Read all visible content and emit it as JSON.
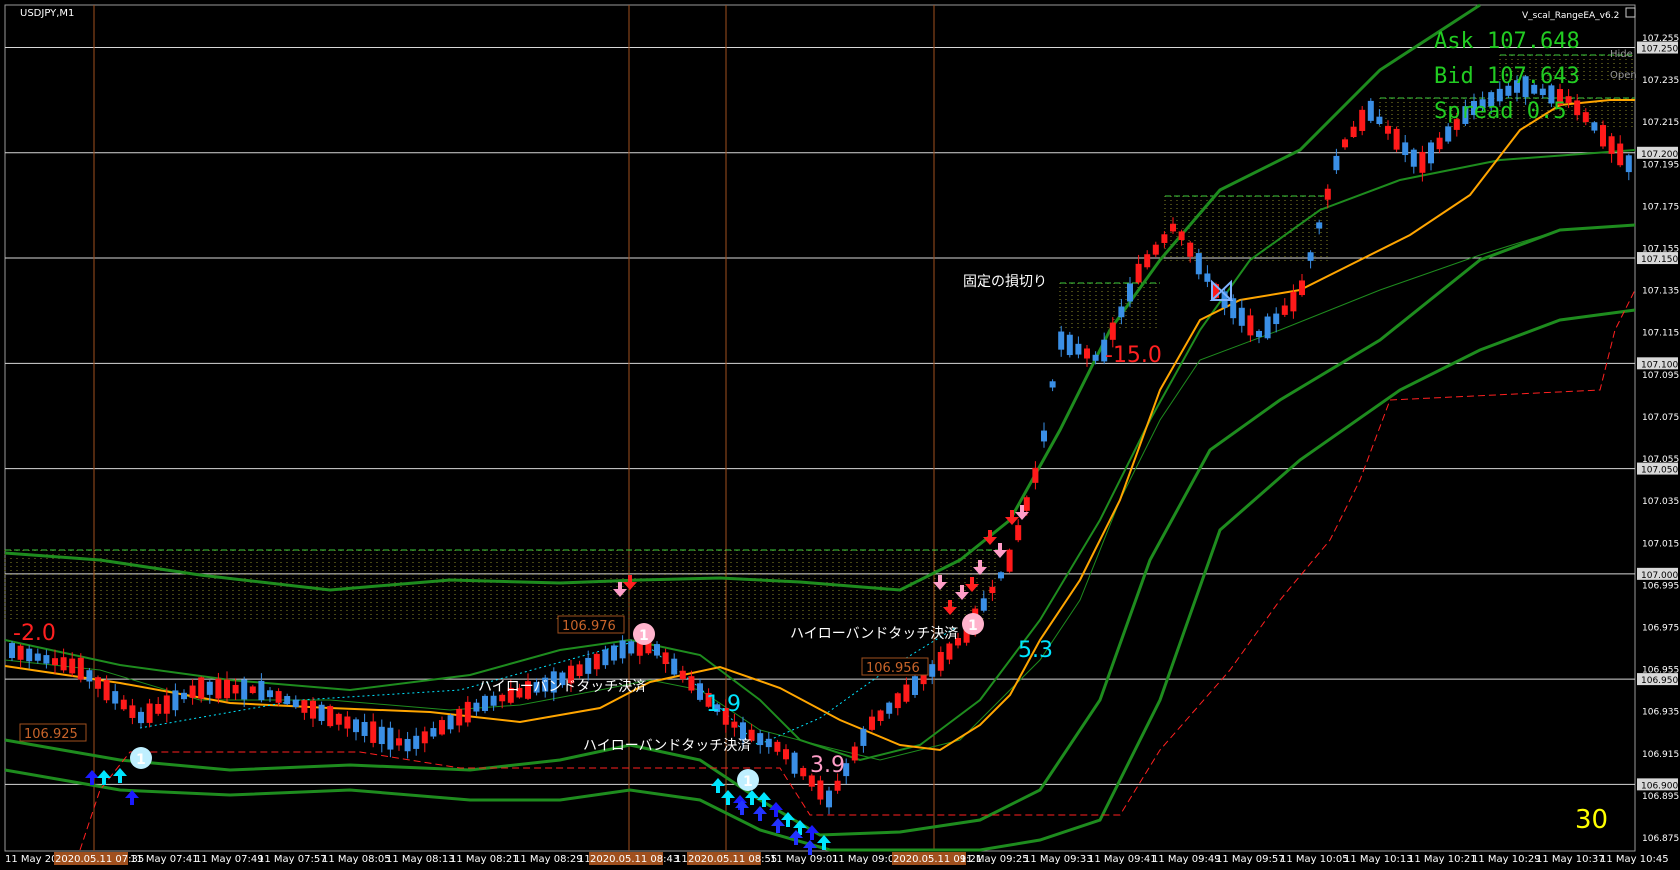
{
  "window": {
    "symbol_title": "USDJPY,M1",
    "ea_title": "V_scal_RangeEA_v6.2",
    "hide_label": "Hide",
    "open_label": "Open",
    "timeframe_number": "30"
  },
  "quote_panel": {
    "ask": "Ask 107.648",
    "bid": "Bid 107.643",
    "spread": "Spread 0.5"
  },
  "annotations": {
    "stop_loss_label": "固定の損切り",
    "touch_label_1": "ハイローバンドタッチ決済",
    "touch_label_2": "ハイローバンドタッチ決済",
    "touch_label_3": "ハイローバンドタッチ決済",
    "pnl_minus2": "-2.0",
    "pnl_1_9": "1.9",
    "pnl_3_9": "3.9",
    "pnl_5_3": "5.3",
    "pnl_minus15": "-15.0",
    "price_tag_1": "106.925",
    "price_tag_2": "106.976",
    "price_tag_3": "106.956",
    "circle_num": "1"
  },
  "price_axis": {
    "ticks": [
      "107.255",
      "107.235",
      "107.215",
      "107.195",
      "107.175",
      "107.155",
      "107.135",
      "107.115",
      "107.095",
      "107.075",
      "107.055",
      "107.035",
      "107.015",
      "106.995",
      "106.975",
      "106.955",
      "106.935",
      "106.915",
      "106.895",
      "106.875"
    ],
    "highlighted": [
      "107.250",
      "107.200",
      "107.150",
      "107.100",
      "107.050",
      "107.000",
      "106.950",
      "106.900"
    ]
  },
  "time_axis": {
    "labels": [
      "11 May 202",
      "2020.05.11 07:35",
      "11 May 07:41",
      "11 May 07:49",
      "11 May 07:57",
      "11 May 08:05",
      "11 May 08:13",
      "11 May 08:21",
      "11 May 08:29",
      "11 May 08:3",
      "2020.05.11 08:43",
      "11 May 0",
      "2020.05.11 08:55",
      "11 May 09:01",
      "11 May 09:0",
      "2020.05.11 09:21",
      "11 May 09:25",
      "11 May 09:33",
      "11 May 09:41",
      "11 May 09:49",
      "11 May 09:57",
      "11 May 10:05",
      "11 May 10:13",
      "11 May 10:21",
      "11 May 10:29",
      "11 May 10:37",
      "11 May 10:45"
    ]
  },
  "colors": {
    "bull": "#3a8fe6",
    "bear": "#ff1a1a",
    "band": "#1e8c1e",
    "ma": "#ffa500",
    "grid": "#d8d8d8",
    "vline": "#a0501e",
    "cyan": "#00e5ff",
    "pink": "#ff9ec8",
    "green_text": "#22cc22",
    "yellow": "#ffff00"
  }
}
